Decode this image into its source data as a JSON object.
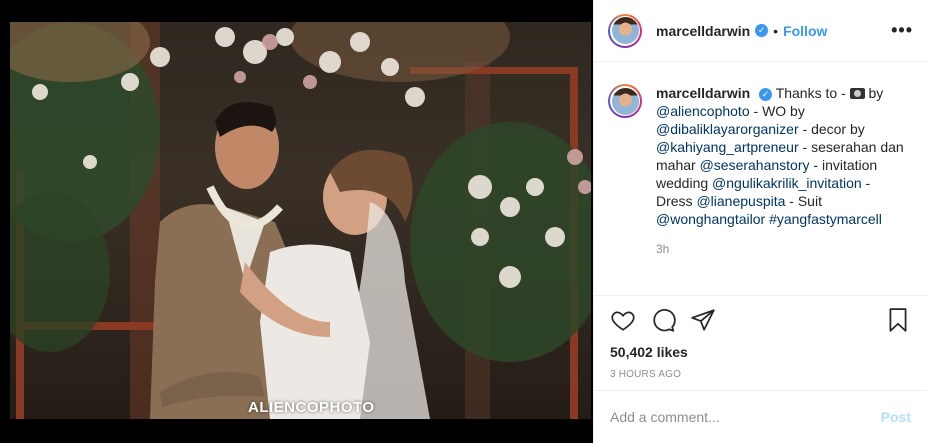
{
  "photo": {
    "watermark": "ALIENCOPHOTO"
  },
  "header": {
    "username": "marcelldarwin",
    "verified_icon": "verified-badge-icon",
    "separator": "•",
    "follow_label": "Follow",
    "more_label": "•••"
  },
  "caption": {
    "username": "marcelldarwin",
    "parts": {
      "p1": "Thanks to - ",
      "p2": " by ",
      "m1": "@aliencophoto",
      "p3": " - WO by ",
      "m2": "@dibaliklayarorganizer",
      "p4": " - decor by ",
      "m3": "@kahiyang_artpreneur",
      "p5": " - seserahan dan mahar ",
      "m4": "@seserahanstory",
      "p6": " - invitation wedding ",
      "m5": "@ngulikakrilik_invitation",
      "p7": " - Dress ",
      "m6": "@lianepuspita",
      "p8": " - Suit ",
      "m7": "@wonghangtailor",
      "p9": " ",
      "h1": "#yangfastymarcell"
    },
    "camera_icon": "camera-emoji-icon",
    "time": "3h"
  },
  "actions": {
    "like_icon": "heart-icon",
    "comment_icon": "comment-icon",
    "share_icon": "share-icon",
    "save_icon": "bookmark-icon",
    "likes": "50,402 likes",
    "posted": "3 HOURS AGO"
  },
  "add_comment": {
    "placeholder": "Add a comment...",
    "post_label": "Post"
  },
  "colors": {
    "link": "#003569",
    "accent": "#3897f0",
    "post_disabled": "#b2dffc"
  }
}
